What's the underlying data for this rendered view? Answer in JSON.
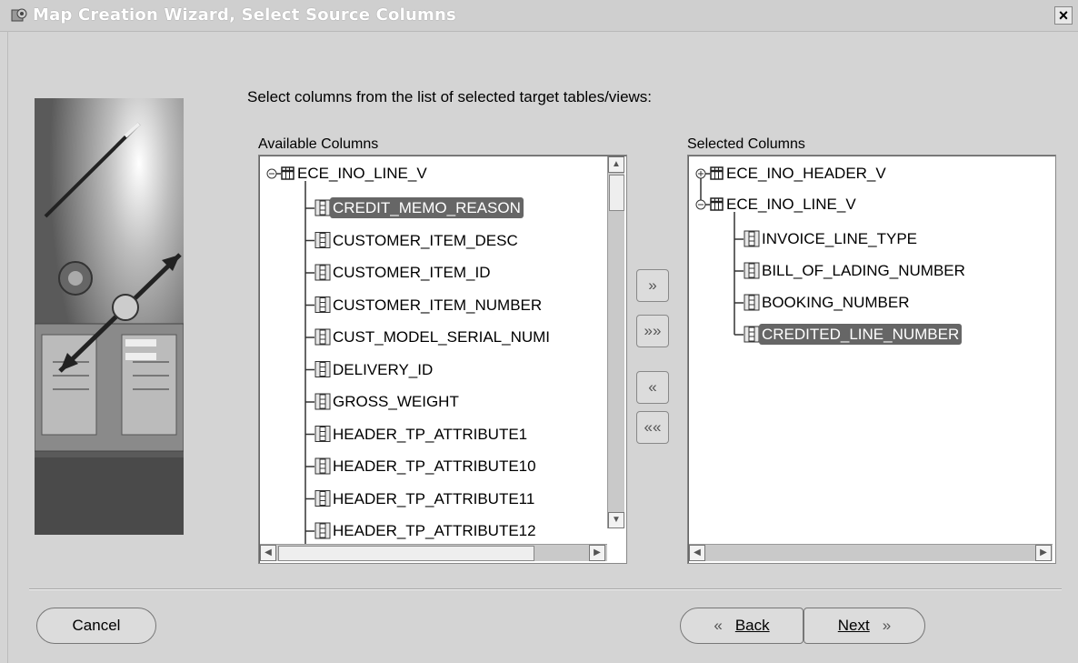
{
  "window": {
    "title": "Map Creation Wizard, Select Source Columns",
    "close_label": "×"
  },
  "instruction": "Select columns from the list of selected target tables/views:",
  "available": {
    "label": "Available Columns",
    "root": "ECE_INO_LINE_V",
    "items": [
      {
        "label": "CREDIT_MEMO_REASON",
        "selected": true
      },
      {
        "label": "CUSTOMER_ITEM_DESC"
      },
      {
        "label": "CUSTOMER_ITEM_ID"
      },
      {
        "label": "CUSTOMER_ITEM_NUMBER"
      },
      {
        "label": "CUST_MODEL_SERIAL_NUMI"
      },
      {
        "label": "DELIVERY_ID"
      },
      {
        "label": "GROSS_WEIGHT"
      },
      {
        "label": "HEADER_TP_ATTRIBUTE1"
      },
      {
        "label": "HEADER_TP_ATTRIBUTE10"
      },
      {
        "label": "HEADER_TP_ATTRIBUTE11"
      },
      {
        "label": "HEADER_TP_ATTRIBUTE12"
      }
    ]
  },
  "selected": {
    "label": "Selected Columns",
    "root_collapsed": "ECE_INO_HEADER_V",
    "root_expanded": "ECE_INO_LINE_V",
    "items": [
      {
        "label": "INVOICE_LINE_TYPE"
      },
      {
        "label": "BILL_OF_LADING_NUMBER"
      },
      {
        "label": "BOOKING_NUMBER"
      },
      {
        "label": "CREDITED_LINE_NUMBER",
        "selected": true
      }
    ]
  },
  "shuttle": {
    "move": "»",
    "move_all": "»»",
    "remove": "«",
    "remove_all": "««"
  },
  "footer": {
    "cancel": "Cancel",
    "back": "Back",
    "next": "Next",
    "back_arrow": "«",
    "next_arrow": "»"
  },
  "colors": {
    "background": "#d4d4d4",
    "selection": "#666666",
    "list_background": "#ffffff"
  }
}
